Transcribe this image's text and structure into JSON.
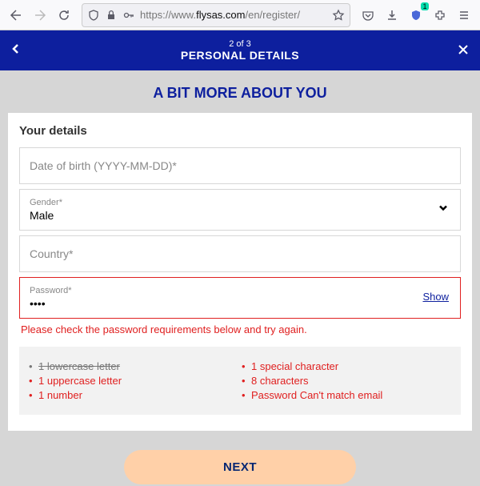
{
  "browser": {
    "url_prefix": "https://www.",
    "url_domain": "flysas.com",
    "url_path": "/en/register/",
    "badge": "1"
  },
  "header": {
    "step": "2 of 3",
    "title": "PERSONAL DETAILS"
  },
  "section_title": "A BIT MORE ABOUT YOU",
  "form": {
    "heading": "Your details",
    "dob_placeholder": "Date of birth (YYYY-MM-DD)*",
    "gender_label": "Gender*",
    "gender_value": "Male",
    "country_label": "Country*",
    "password_label": "Password*",
    "password_value": "••••",
    "show_label": "Show",
    "error": "Please check the password requirements below and try again."
  },
  "requirements": {
    "left": [
      {
        "text": "1 lowercase letter",
        "met": true
      },
      {
        "text": "1 uppercase letter",
        "met": false
      },
      {
        "text": "1 number",
        "met": false
      }
    ],
    "right": [
      {
        "text": "1 special character",
        "met": false
      },
      {
        "text": "8 characters",
        "met": false
      },
      {
        "text": "Password Can't match email",
        "met": false
      }
    ]
  },
  "next_label": "NEXT"
}
